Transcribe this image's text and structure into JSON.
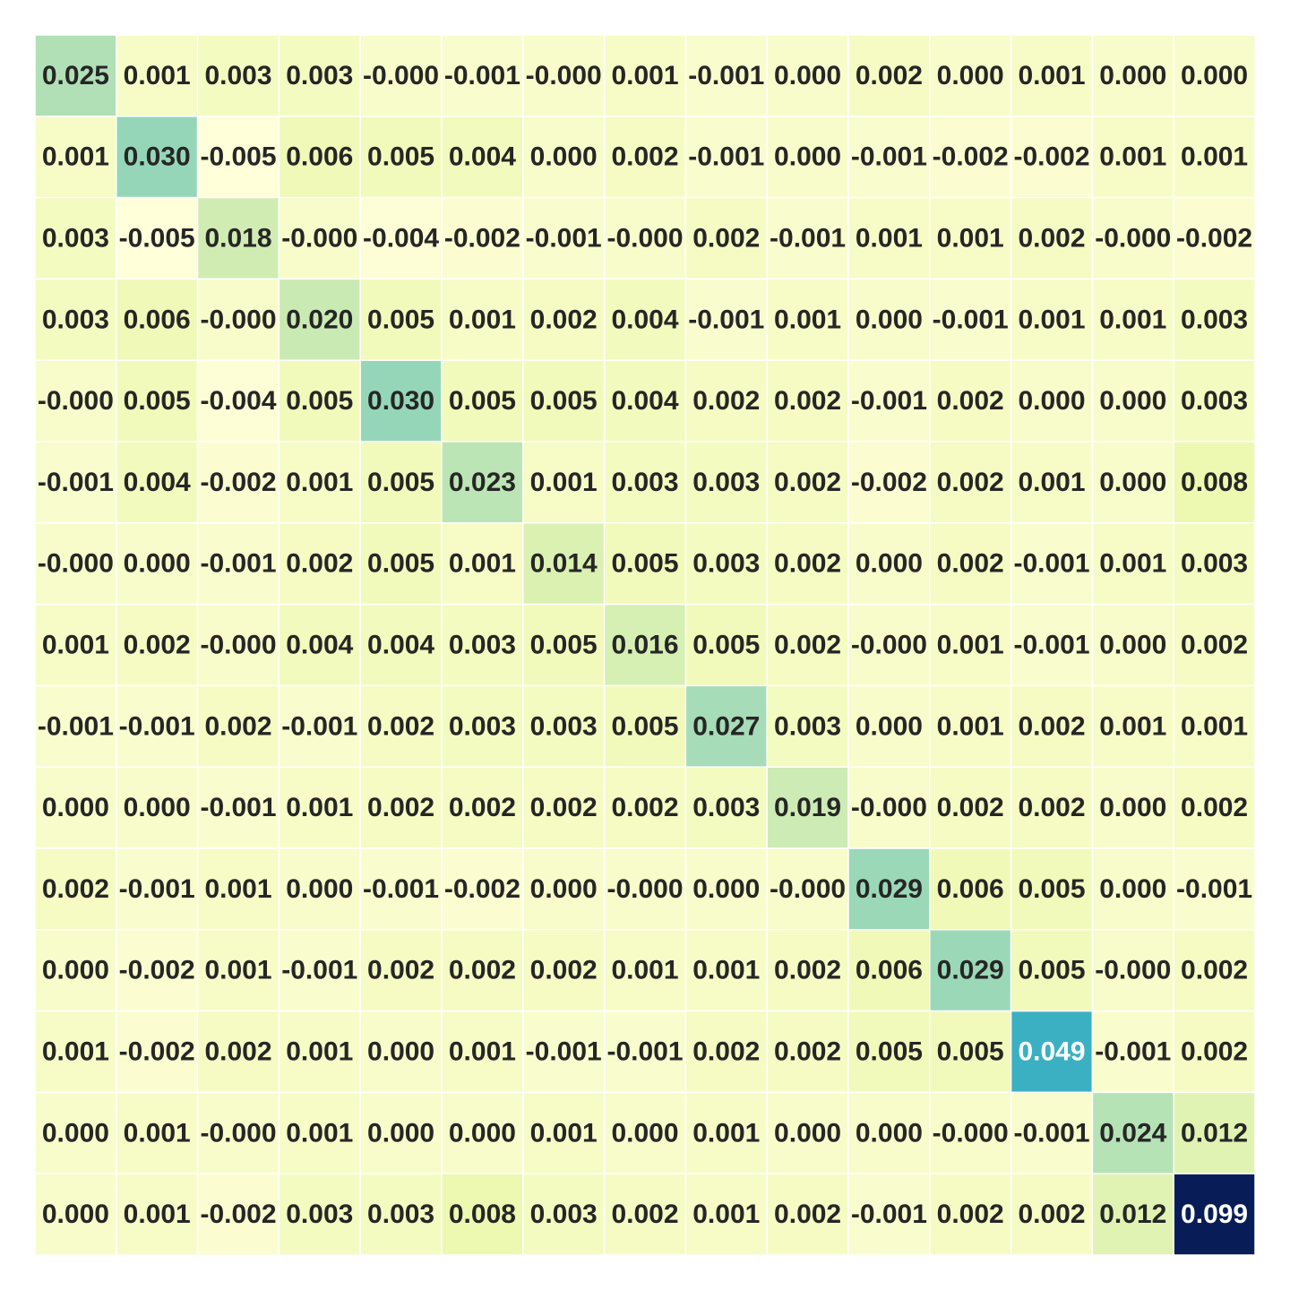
{
  "chart_data": {
    "type": "heatmap",
    "title": "",
    "xlabel": "",
    "ylabel": "",
    "colormap": "YlGnBu",
    "colorscale_range": [
      -0.005,
      0.099
    ],
    "annotation_format": "0.000",
    "grid_lines": true,
    "grid_color": "#ffffff",
    "values": [
      [
        "0.025",
        "0.001",
        "0.003",
        "0.003",
        "-0.000",
        "-0.001",
        "-0.000",
        "0.001",
        "-0.001",
        "0.000",
        "0.002",
        "0.000",
        "0.001",
        "0.000",
        "0.000"
      ],
      [
        "0.001",
        "0.030",
        "-0.005",
        "0.006",
        "0.005",
        "0.004",
        "0.000",
        "0.002",
        "-0.001",
        "0.000",
        "-0.001",
        "-0.002",
        "-0.002",
        "0.001",
        "0.001"
      ],
      [
        "0.003",
        "-0.005",
        "0.018",
        "-0.000",
        "-0.004",
        "-0.002",
        "-0.001",
        "-0.000",
        "0.002",
        "-0.001",
        "0.001",
        "0.001",
        "0.002",
        "-0.000",
        "-0.002"
      ],
      [
        "0.003",
        "0.006",
        "-0.000",
        "0.020",
        "0.005",
        "0.001",
        "0.002",
        "0.004",
        "-0.001",
        "0.001",
        "0.000",
        "-0.001",
        "0.001",
        "0.001",
        "0.003"
      ],
      [
        "-0.000",
        "0.005",
        "-0.004",
        "0.005",
        "0.030",
        "0.005",
        "0.005",
        "0.004",
        "0.002",
        "0.002",
        "-0.001",
        "0.002",
        "0.000",
        "0.000",
        "0.003"
      ],
      [
        "-0.001",
        "0.004",
        "-0.002",
        "0.001",
        "0.005",
        "0.023",
        "0.001",
        "0.003",
        "0.003",
        "0.002",
        "-0.002",
        "0.002",
        "0.001",
        "0.000",
        "0.008"
      ],
      [
        "-0.000",
        "0.000",
        "-0.001",
        "0.002",
        "0.005",
        "0.001",
        "0.014",
        "0.005",
        "0.003",
        "0.002",
        "0.000",
        "0.002",
        "-0.001",
        "0.001",
        "0.003"
      ],
      [
        "0.001",
        "0.002",
        "-0.000",
        "0.004",
        "0.004",
        "0.003",
        "0.005",
        "0.016",
        "0.005",
        "0.002",
        "-0.000",
        "0.001",
        "-0.001",
        "0.000",
        "0.002"
      ],
      [
        "-0.001",
        "-0.001",
        "0.002",
        "-0.001",
        "0.002",
        "0.003",
        "0.003",
        "0.005",
        "0.027",
        "0.003",
        "0.000",
        "0.001",
        "0.002",
        "0.001",
        "0.001"
      ],
      [
        "0.000",
        "0.000",
        "-0.001",
        "0.001",
        "0.002",
        "0.002",
        "0.002",
        "0.002",
        "0.003",
        "0.019",
        "-0.000",
        "0.002",
        "0.002",
        "0.000",
        "0.002"
      ],
      [
        "0.002",
        "-0.001",
        "0.001",
        "0.000",
        "-0.001",
        "-0.002",
        "0.000",
        "-0.000",
        "0.000",
        "-0.000",
        "0.029",
        "0.006",
        "0.005",
        "0.000",
        "-0.001"
      ],
      [
        "0.000",
        "-0.002",
        "0.001",
        "-0.001",
        "0.002",
        "0.002",
        "0.002",
        "0.001",
        "0.001",
        "0.002",
        "0.006",
        "0.029",
        "0.005",
        "-0.000",
        "0.002"
      ],
      [
        "0.001",
        "-0.002",
        "0.002",
        "0.001",
        "0.000",
        "0.001",
        "-0.001",
        "-0.001",
        "0.002",
        "0.002",
        "0.005",
        "0.005",
        "0.049",
        "-0.001",
        "0.002"
      ],
      [
        "0.000",
        "0.001",
        "-0.000",
        "0.001",
        "0.000",
        "0.000",
        "0.001",
        "0.000",
        "0.001",
        "0.000",
        "0.000",
        "-0.000",
        "-0.001",
        "0.024",
        "0.012"
      ],
      [
        "0.000",
        "0.001",
        "-0.002",
        "0.003",
        "0.003",
        "0.008",
        "0.003",
        "0.002",
        "0.001",
        "0.002",
        "-0.001",
        "0.002",
        "0.002",
        "0.012",
        "0.099"
      ]
    ]
  }
}
